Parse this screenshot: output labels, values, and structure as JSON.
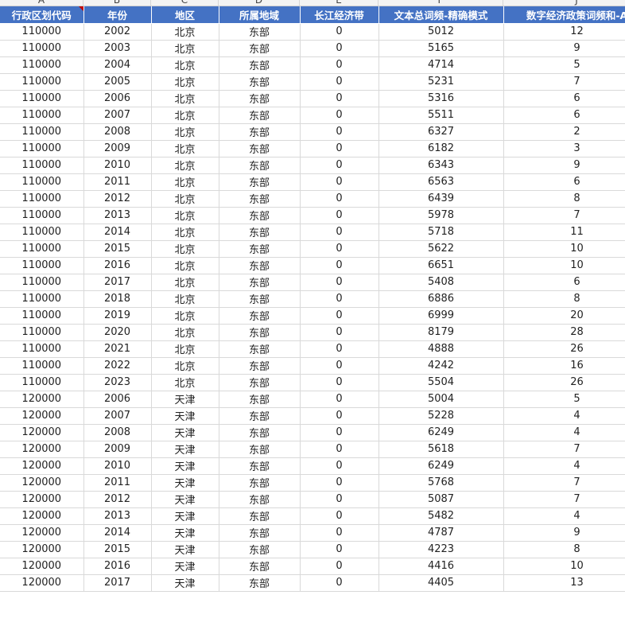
{
  "sheet": {
    "column_letters": [
      "A",
      "B",
      "C",
      "D",
      "E",
      "F",
      "J"
    ],
    "headers": [
      "行政区划代码",
      "年份",
      "地区",
      "所属地域",
      "长江经济带",
      "文本总词频-精确模式",
      "数字经济政策词频和-A"
    ],
    "rows": [
      [
        "110000",
        "2002",
        "北京",
        "东部",
        "0",
        "5012",
        "12"
      ],
      [
        "110000",
        "2003",
        "北京",
        "东部",
        "0",
        "5165",
        "9"
      ],
      [
        "110000",
        "2004",
        "北京",
        "东部",
        "0",
        "4714",
        "5"
      ],
      [
        "110000",
        "2005",
        "北京",
        "东部",
        "0",
        "5231",
        "7"
      ],
      [
        "110000",
        "2006",
        "北京",
        "东部",
        "0",
        "5316",
        "6"
      ],
      [
        "110000",
        "2007",
        "北京",
        "东部",
        "0",
        "5511",
        "6"
      ],
      [
        "110000",
        "2008",
        "北京",
        "东部",
        "0",
        "6327",
        "2"
      ],
      [
        "110000",
        "2009",
        "北京",
        "东部",
        "0",
        "6182",
        "3"
      ],
      [
        "110000",
        "2010",
        "北京",
        "东部",
        "0",
        "6343",
        "9"
      ],
      [
        "110000",
        "2011",
        "北京",
        "东部",
        "0",
        "6563",
        "6"
      ],
      [
        "110000",
        "2012",
        "北京",
        "东部",
        "0",
        "6439",
        "8"
      ],
      [
        "110000",
        "2013",
        "北京",
        "东部",
        "0",
        "5978",
        "7"
      ],
      [
        "110000",
        "2014",
        "北京",
        "东部",
        "0",
        "5718",
        "11"
      ],
      [
        "110000",
        "2015",
        "北京",
        "东部",
        "0",
        "5622",
        "10"
      ],
      [
        "110000",
        "2016",
        "北京",
        "东部",
        "0",
        "6651",
        "10"
      ],
      [
        "110000",
        "2017",
        "北京",
        "东部",
        "0",
        "5408",
        "6"
      ],
      [
        "110000",
        "2018",
        "北京",
        "东部",
        "0",
        "6886",
        "8"
      ],
      [
        "110000",
        "2019",
        "北京",
        "东部",
        "0",
        "6999",
        "20"
      ],
      [
        "110000",
        "2020",
        "北京",
        "东部",
        "0",
        "8179",
        "28"
      ],
      [
        "110000",
        "2021",
        "北京",
        "东部",
        "0",
        "4888",
        "26"
      ],
      [
        "110000",
        "2022",
        "北京",
        "东部",
        "0",
        "4242",
        "16"
      ],
      [
        "110000",
        "2023",
        "北京",
        "东部",
        "0",
        "5504",
        "26"
      ],
      [
        "120000",
        "2006",
        "天津",
        "东部",
        "0",
        "5004",
        "5"
      ],
      [
        "120000",
        "2007",
        "天津",
        "东部",
        "0",
        "5228",
        "4"
      ],
      [
        "120000",
        "2008",
        "天津",
        "东部",
        "0",
        "6249",
        "4"
      ],
      [
        "120000",
        "2009",
        "天津",
        "东部",
        "0",
        "5618",
        "7"
      ],
      [
        "120000",
        "2010",
        "天津",
        "东部",
        "0",
        "6249",
        "4"
      ],
      [
        "120000",
        "2011",
        "天津",
        "东部",
        "0",
        "5768",
        "7"
      ],
      [
        "120000",
        "2012",
        "天津",
        "东部",
        "0",
        "5087",
        "7"
      ],
      [
        "120000",
        "2013",
        "天津",
        "东部",
        "0",
        "5482",
        "4"
      ],
      [
        "120000",
        "2014",
        "天津",
        "东部",
        "0",
        "4787",
        "9"
      ],
      [
        "120000",
        "2015",
        "天津",
        "东部",
        "0",
        "4223",
        "8"
      ],
      [
        "120000",
        "2016",
        "天津",
        "东部",
        "0",
        "4416",
        "10"
      ],
      [
        "120000",
        "2017",
        "天津",
        "东部",
        "0",
        "4405",
        "13"
      ]
    ]
  },
  "colors": {
    "header_bg": "#4472c4",
    "header_text": "#ffffff",
    "grid_line": "#d9d9d9",
    "comment_marker": "#c00000"
  }
}
